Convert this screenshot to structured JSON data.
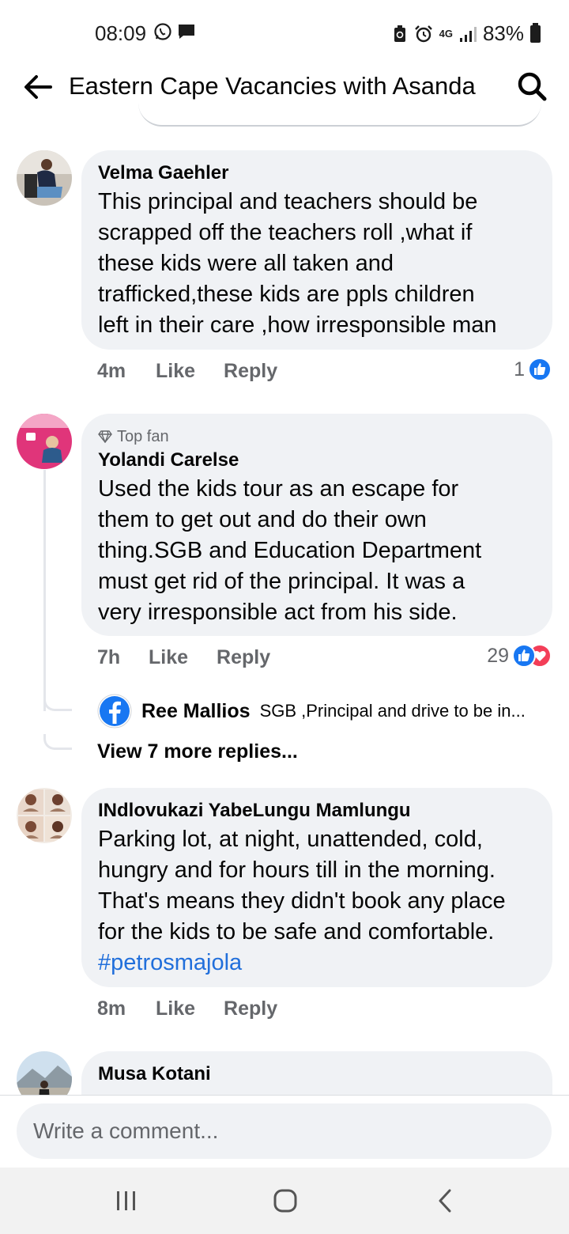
{
  "status_bar": {
    "time": "08:09",
    "network": "4G",
    "battery": "83%"
  },
  "header": {
    "title": "Eastern Cape Vacancies with Asanda",
    "back_icon": "arrow-left-icon",
    "search_icon": "search-icon"
  },
  "comments": [
    {
      "author": "Velma Gaehler",
      "text_lines": [
        "This principal and teachers should be",
        "scrapped off the teachers roll ,what if",
        "these kids were all taken and",
        "trafficked,these kids are ppls children",
        "left in their care ,how irresponsible man"
      ],
      "time": "4m",
      "like_label": "Like",
      "reply_label": "Reply",
      "reaction_count": "1"
    },
    {
      "badge": "Top fan",
      "author": "Yolandi Carelse",
      "text_lines": [
        "Used the kids tour as an escape for",
        "them to get out and do their own",
        "thing.SGB and Education Department",
        "must get rid of the principal. It was a",
        "very irresponsible act from his side."
      ],
      "time": "7h",
      "like_label": "Like",
      "reply_label": "Reply",
      "reaction_count": "29",
      "reply_preview": {
        "author": "Ree Mallios",
        "text": "SGB ,Principal and drive to be in..."
      },
      "view_more": "View 7 more replies..."
    },
    {
      "author": "INdlovukazi YabeLungu Mamlungu",
      "text_lines": [
        "Parking lot, at night, unattended, cold,",
        "hungry and for hours till in the morning.",
        "That's means they didn't book any place",
        "for the kids to be safe and comfortable."
      ],
      "hashtag": "#petrosmajola",
      "time": "8m",
      "like_label": "Like",
      "reply_label": "Reply"
    },
    {
      "author": "Musa Kotani"
    }
  ],
  "composer": {
    "placeholder": "Write a comment..."
  },
  "colors": {
    "bubble": "#f0f2f5",
    "meta": "#65676b",
    "link": "#216fdb",
    "like_blue": "#1877f2",
    "love_red": "#f33e58"
  }
}
